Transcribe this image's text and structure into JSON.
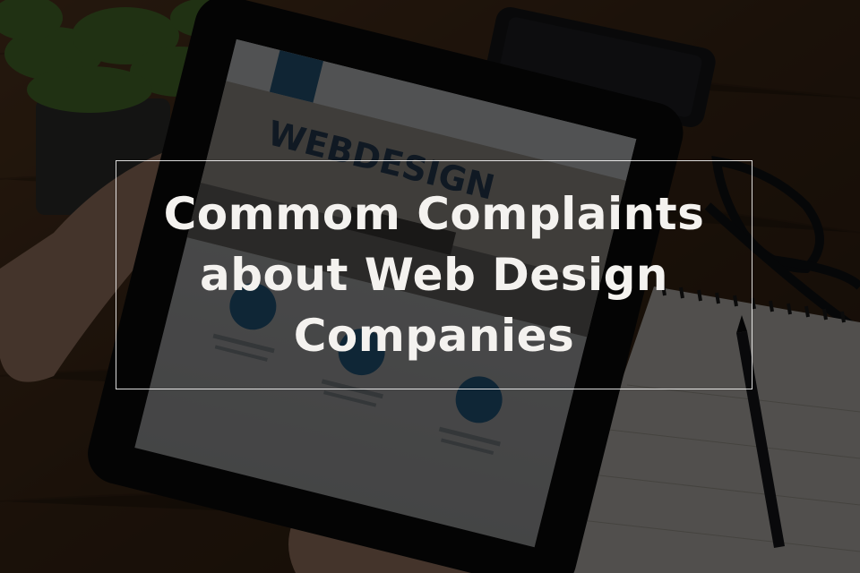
{
  "banner": {
    "title_lines": [
      "Commom Complaints",
      "about Web Design",
      "Companies"
    ]
  },
  "colors": {
    "overlay": "#000000",
    "title_text": "#f4f2ef",
    "frame_border": "#ffffff",
    "desk_wood": "#5a3b22",
    "tablet_bezel": "#0c0c0d",
    "icon_circle": "#2e6f9e"
  }
}
